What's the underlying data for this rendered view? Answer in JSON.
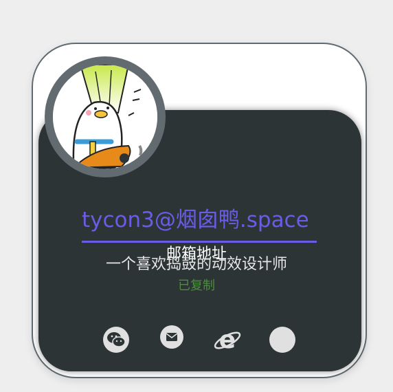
{
  "profile": {
    "email": "tycon3@烟囱鸭.space",
    "email_label": "邮箱地址",
    "tagline": "一个喜欢捣鼓的动效设计师",
    "copied_status": "已复制"
  },
  "avatar": {
    "description_icon": "cartoon-duck-avatar"
  },
  "social_icons": [
    "wechat-icon",
    "mail-icon",
    "ie-browser-icon",
    "blank-circle-icon"
  ],
  "colors": {
    "page_bg": "#eeeeee",
    "card_bg": "#ffffff",
    "card_border": "#5f6b70",
    "panel_bg": "#2d3436",
    "accent": "#6b5ce7",
    "copied": "#4a8f3c",
    "icon": "#e0e0e0"
  }
}
